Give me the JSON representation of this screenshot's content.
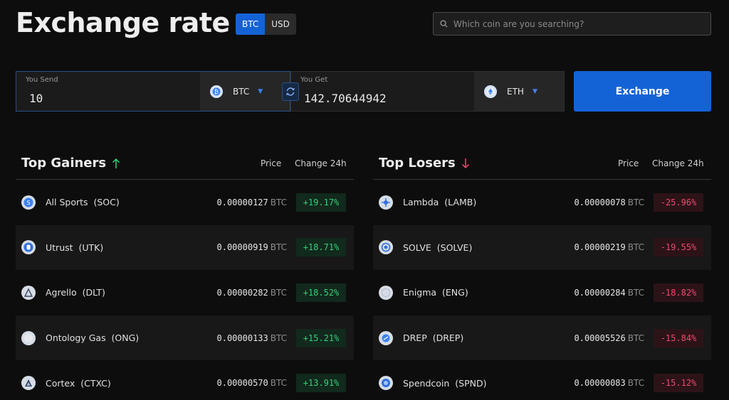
{
  "header": {
    "title": "Exchange rate",
    "currency_toggle": {
      "options": [
        "BTC",
        "USD"
      ],
      "selected": "BTC"
    },
    "search_placeholder": "Which coin are you searching?"
  },
  "exchange": {
    "send_label": "You Send",
    "send_value": "10",
    "send_coin": "BTC",
    "get_label": "You Get",
    "get_value": "142.70644942",
    "get_coin": "ETH",
    "button_label": "Exchange"
  },
  "columns": {
    "price": "Price",
    "change": "Change 24h"
  },
  "gainers": {
    "title": "Top Gainers",
    "rows": [
      {
        "name": "All Sports  (SOC)",
        "price": "0.00000127",
        "unit": "BTC",
        "change": "+19.17%"
      },
      {
        "name": "Utrust  (UTK)",
        "price": "0.00000919",
        "unit": "BTC",
        "change": "+18.71%"
      },
      {
        "name": "Agrello  (DLT)",
        "price": "0.00000282",
        "unit": "BTC",
        "change": "+18.52%"
      },
      {
        "name": "Ontology Gas  (ONG)",
        "price": "0.00000133",
        "unit": "BTC",
        "change": "+15.21%"
      },
      {
        "name": "Cortex  (CTXC)",
        "price": "0.00000570",
        "unit": "BTC",
        "change": "+13.91%"
      }
    ]
  },
  "losers": {
    "title": "Top Losers",
    "rows": [
      {
        "name": "Lambda  (LAMB)",
        "price": "0.00000078",
        "unit": "BTC",
        "change": "-25.96%"
      },
      {
        "name": "SOLVE  (SOLVE)",
        "price": "0.00000219",
        "unit": "BTC",
        "change": "-19.55%"
      },
      {
        "name": "Enigma  (ENG)",
        "price": "0.00000284",
        "unit": "BTC",
        "change": "-18.82%"
      },
      {
        "name": "DREP  (DREP)",
        "price": "0.00005526",
        "unit": "BTC",
        "change": "-15.84%"
      },
      {
        "name": "Spendcoin  (SPND)",
        "price": "0.00000083",
        "unit": "BTC",
        "change": "-15.12%"
      }
    ]
  },
  "colors": {
    "accent": "#1463d6",
    "gain": "#33d17a",
    "loss": "#f0486e",
    "background": "#0d0d0d"
  }
}
